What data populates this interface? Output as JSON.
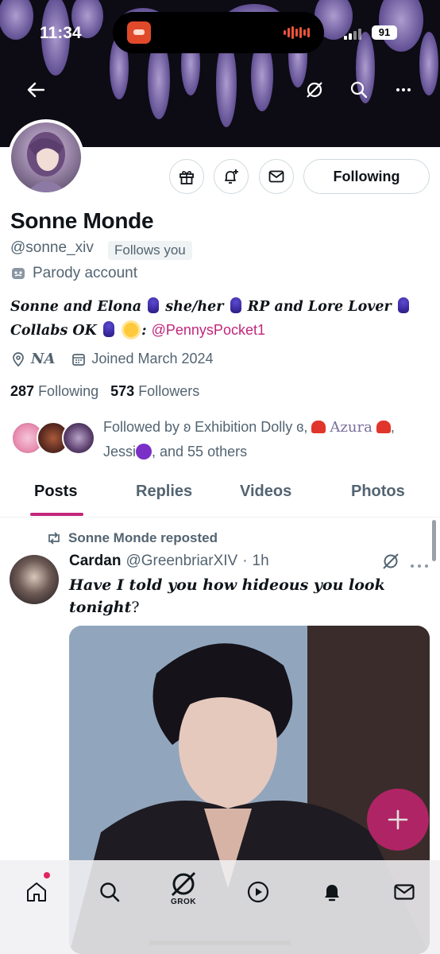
{
  "status_bar": {
    "time": "11:34",
    "battery": "91"
  },
  "profile": {
    "name": "Sonne Monde",
    "handle": "@sonne_xiv",
    "follows_you_badge": "Follows you",
    "parody_label": "Parody account",
    "bio_line1_a": "Sonne and Elona",
    "bio_line1_b": "she/her",
    "bio_line1_c": "RP and Lore Lover",
    "bio_line2_a": "Collabs OK",
    "bio_line2_b": ":",
    "bio_link": "@PennysPocket1",
    "location": "NA",
    "joined": "Joined March 2024",
    "following_count": "287",
    "following_label": "Following",
    "followers_count": "573",
    "followers_label": "Followers",
    "follow_button": "Following",
    "followed_by_a": "Followed by ʚ Exhibition Dolly ɞ,",
    "followed_by_b": "Azura",
    "followed_by_c": ",",
    "followed_by_d": "Jessi",
    "followed_by_e": ", and 55 others"
  },
  "tabs": [
    "Posts",
    "Replies",
    "Videos",
    "Photos"
  ],
  "post": {
    "repost_label": "Sonne Monde reposted",
    "author_name": "Cardan",
    "author_handle": "@GreenbriarXIV",
    "separator": "·",
    "time": "1h",
    "text_italic": "Have I told you how hideous you look tonight",
    "text_end": "?"
  },
  "nav": {
    "grok_label": "GROK"
  },
  "colors": {
    "accent": "#c1267b",
    "fab": "#c4236f",
    "text_secondary": "#536471"
  },
  "icons": [
    "back-arrow-icon",
    "grok-icon",
    "search-icon",
    "more-icon",
    "gift-icon",
    "bell-plus-icon",
    "mail-icon",
    "theater-masks-icon",
    "location-pin-icon",
    "calendar-icon",
    "repost-icon",
    "plus-icon",
    "home-icon",
    "bell-icon"
  ]
}
